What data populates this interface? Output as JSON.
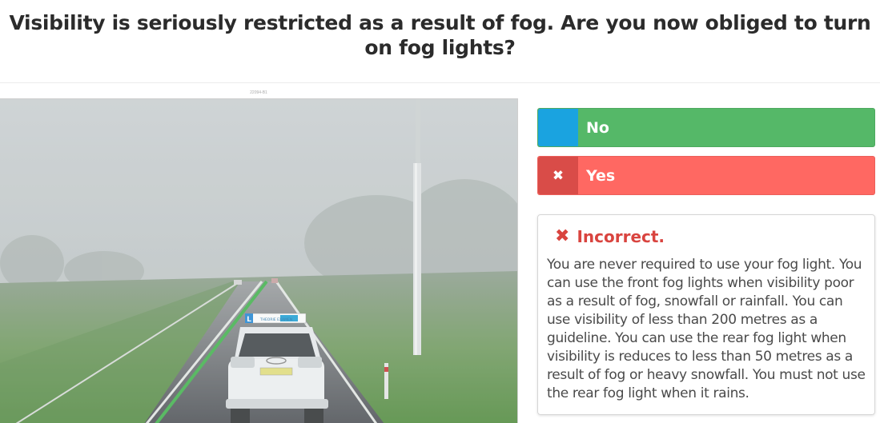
{
  "question": {
    "title": "Visibility is seriously restricted as a result of fog. Are you now obliged to turn on fog lights?"
  },
  "image": {
    "id_caption": "22094-B1",
    "car_sign_text": "THEORIE EXAMEN",
    "learner_plate": "L"
  },
  "answers": [
    {
      "label": "No",
      "state": "correct",
      "marker_color": "#1aa3e0"
    },
    {
      "label": "Yes",
      "state": "selected-wrong",
      "icon": "x-icon"
    }
  ],
  "feedback": {
    "status": "Incorrect.",
    "icon": "x-icon",
    "explanation": "You are never required to use your fog light. You can use the front fog lights when visibility poor as a result of fog, snowfall or rainfall. You can use visibility of less than 200 metres as a guideline. You can use the rear fog light when visibility is reduces to less than 50 metres as a result of fog or heavy snowfall. You must not use the rear fog light when it rains."
  },
  "colors": {
    "correct": "#55b868",
    "wrong": "#ff6862",
    "incorrect_text": "#d9443f"
  }
}
